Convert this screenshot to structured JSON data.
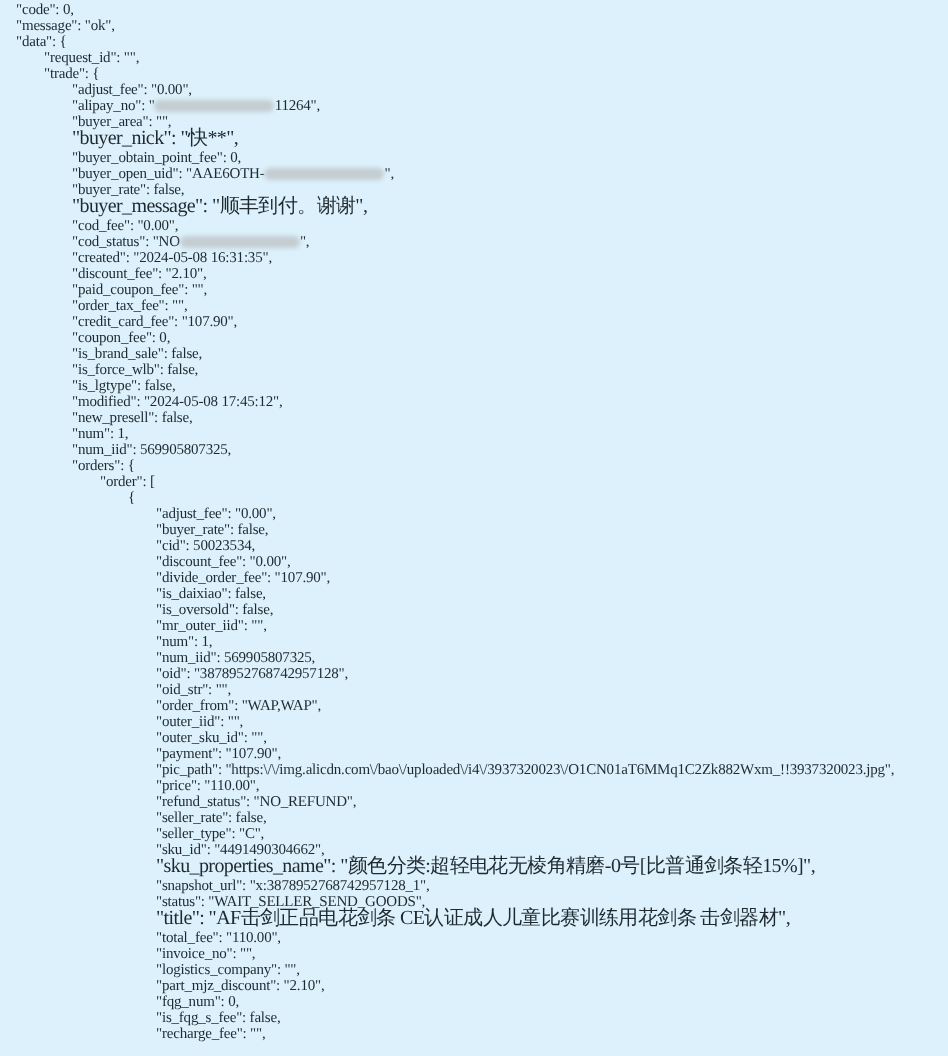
{
  "lines": [
    {
      "kind": "plain",
      "text": "\"code\": 0,"
    },
    {
      "kind": "plain",
      "text": "\"message\": \"ok\","
    },
    {
      "kind": "plain",
      "text": "\"data\": {",
      "children": [
        {
          "kind": "plain",
          "text": "\"request_id\": \"\","
        },
        {
          "kind": "plain",
          "text": "\"trade\": {",
          "children": [
            {
              "kind": "plain",
              "text": "\"adjust_fee\": \"0.00\","
            },
            {
              "kind": "plain",
              "text": "\"alipay_no\": \"",
              "redacted": true,
              "after": "11264\","
            },
            {
              "kind": "plain",
              "text": "\"buyer_area\": \"\","
            },
            {
              "kind": "cjk",
              "text": "\"buyer_nick\": \"快**\","
            },
            {
              "kind": "plain",
              "text": "\"buyer_obtain_point_fee\": 0,"
            },
            {
              "kind": "plain",
              "text": "\"buyer_open_uid\": \"AAE6OTH-",
              "redacted": true,
              "after": "\","
            },
            {
              "kind": "plain",
              "text": "\"buyer_rate\": false,"
            },
            {
              "kind": "cjk",
              "text": "\"buyer_message\": \"顺丰到付。谢谢\","
            },
            {
              "kind": "plain",
              "text": "\"cod_fee\": \"0.00\","
            },
            {
              "kind": "plain",
              "text": "\"cod_status\": \"NO",
              "redacted": true,
              "after": "\","
            },
            {
              "kind": "plain",
              "text": "\"created\": \"2024-05-08 16:31:35\","
            },
            {
              "kind": "plain",
              "text": "\"discount_fee\": \"2.10\","
            },
            {
              "kind": "plain",
              "text": "\"paid_coupon_fee\": \"\","
            },
            {
              "kind": "plain",
              "text": "\"order_tax_fee\": \"\","
            },
            {
              "kind": "plain",
              "text": "\"credit_card_fee\": \"107.90\","
            },
            {
              "kind": "plain",
              "text": "\"coupon_fee\": 0,"
            },
            {
              "kind": "plain",
              "text": "\"is_brand_sale\": false,"
            },
            {
              "kind": "plain",
              "text": "\"is_force_wlb\": false,"
            },
            {
              "kind": "plain",
              "text": "\"is_lgtype\": false,"
            },
            {
              "kind": "plain",
              "text": "\"modified\": \"2024-05-08 17:45:12\","
            },
            {
              "kind": "plain",
              "text": "\"new_presell\": false,"
            },
            {
              "kind": "plain",
              "text": "\"num\": 1,"
            },
            {
              "kind": "plain",
              "text": "\"num_iid\": 569905807325,"
            },
            {
              "kind": "plain",
              "text": "\"orders\": {",
              "children": [
                {
                  "kind": "plain",
                  "text": "\"order\": [",
                  "children": [
                    {
                      "kind": "plain",
                      "text": "{",
                      "children": [
                        {
                          "kind": "plain",
                          "text": "\"adjust_fee\": \"0.00\","
                        },
                        {
                          "kind": "plain",
                          "text": "\"buyer_rate\": false,"
                        },
                        {
                          "kind": "plain",
                          "text": "\"cid\": 50023534,"
                        },
                        {
                          "kind": "plain",
                          "text": "\"discount_fee\": \"0.00\","
                        },
                        {
                          "kind": "plain",
                          "text": "\"divide_order_fee\": \"107.90\","
                        },
                        {
                          "kind": "plain",
                          "text": "\"is_daixiao\": false,"
                        },
                        {
                          "kind": "plain",
                          "text": "\"is_oversold\": false,"
                        },
                        {
                          "kind": "plain",
                          "text": "\"mr_outer_iid\": \"\","
                        },
                        {
                          "kind": "plain",
                          "text": "\"num\": 1,"
                        },
                        {
                          "kind": "plain",
                          "text": "\"num_iid\": 569905807325,"
                        },
                        {
                          "kind": "plain",
                          "text": "\"oid\": \"3878952768742957128\","
                        },
                        {
                          "kind": "plain",
                          "text": "\"oid_str\": \"\","
                        },
                        {
                          "kind": "plain",
                          "text": "\"order_from\": \"WAP,WAP\","
                        },
                        {
                          "kind": "plain",
                          "text": "\"outer_iid\": \"\","
                        },
                        {
                          "kind": "plain",
                          "text": "\"outer_sku_id\": \"\","
                        },
                        {
                          "kind": "plain",
                          "text": "\"payment\": \"107.90\","
                        },
                        {
                          "kind": "plain",
                          "text": "\"pic_path\": \"https:\\/\\/img.alicdn.com\\/bao\\/uploaded\\/i4\\/3937320023\\/O1CN01aT6MMq1C2Zk882Wxm_!!3937320023.jpg\","
                        },
                        {
                          "kind": "plain",
                          "text": "\"price\": \"110.00\","
                        },
                        {
                          "kind": "plain",
                          "text": "\"refund_status\": \"NO_REFUND\","
                        },
                        {
                          "kind": "plain",
                          "text": "\"seller_rate\": false,"
                        },
                        {
                          "kind": "plain",
                          "text": "\"seller_type\": \"C\","
                        },
                        {
                          "kind": "plain",
                          "text": "\"sku_id\": \"4491490304662\","
                        },
                        {
                          "kind": "cjk",
                          "text": "\"sku_properties_name\": \"颜色分类:超轻电花无棱角精磨-0号[比普通剑条轻15%]\","
                        },
                        {
                          "kind": "plain",
                          "text": "\"snapshot_url\": \"x:3878952768742957128_1\","
                        },
                        {
                          "kind": "plain",
                          "text": "\"status\": \"WAIT_SELLER_SEND_GOODS\","
                        },
                        {
                          "kind": "cjk",
                          "text": "\"title\": \"AF击剑正品电花剑条 CE认证成人儿童比赛训练用花剑条 击剑器材\","
                        },
                        {
                          "kind": "plain",
                          "text": "\"total_fee\": \"110.00\","
                        },
                        {
                          "kind": "plain",
                          "text": "\"invoice_no\": \"\","
                        },
                        {
                          "kind": "plain",
                          "text": "\"logistics_company\": \"\","
                        },
                        {
                          "kind": "plain",
                          "text": "\"part_mjz_discount\": \"2.10\","
                        },
                        {
                          "kind": "plain",
                          "text": "\"fqg_num\": 0,"
                        },
                        {
                          "kind": "plain",
                          "text": "\"is_fqg_s_fee\": false,"
                        },
                        {
                          "kind": "plain",
                          "text": "\"recharge_fee\": \"\","
                        }
                      ]
                    }
                  ]
                }
              ]
            }
          ]
        }
      ]
    }
  ]
}
